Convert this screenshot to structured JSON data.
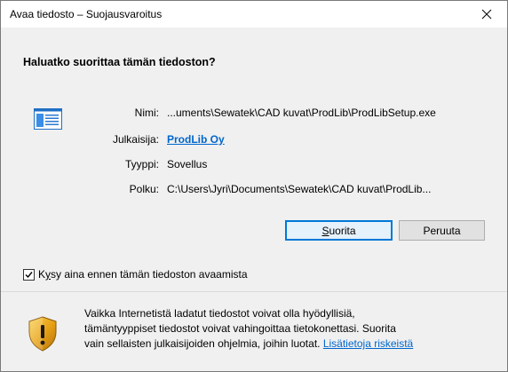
{
  "window": {
    "title": "Avaa tiedosto – Suojausvaroitus"
  },
  "heading": "Haluatko suorittaa tämän tiedoston?",
  "details": {
    "name_label": "Nimi:",
    "name_value": "...uments\\Sewatek\\CAD kuvat\\ProdLib\\ProdLibSetup.exe",
    "publisher_label": "Julkaisija:",
    "publisher_value": "ProdLib Oy",
    "type_label": "Tyyppi:",
    "type_value": "Sovellus",
    "path_label": "Polku:",
    "path_value": "C:\\Users\\Jyri\\Documents\\Sewatek\\CAD kuvat\\ProdLib..."
  },
  "buttons": {
    "run_mnemonic": "S",
    "run_rest": "uorita",
    "cancel": "Peruuta"
  },
  "checkbox": {
    "prefix": "K",
    "mnemonic": "y",
    "rest": "sy aina ennen tämän tiedoston avaamista",
    "checked": true
  },
  "warning": {
    "line1": "Vaikka Internetistä ladatut tiedostot voivat olla hyödyllisiä,",
    "line2": "tämäntyyppiset tiedostot voivat vahingoittaa tietokonettasi. Suorita",
    "line3": "vain sellaisten julkaisijoiden ohjelmia, joihin luotat.",
    "link": "Lisätietoja riskeistä"
  },
  "icons": {
    "close": "close-icon",
    "file": "application-window-icon",
    "shield": "security-shield-warning-icon",
    "check": "checkmark-icon"
  },
  "colors": {
    "link": "#0066cc",
    "default_button_border": "#0078d7",
    "shield_gold": "#e8a317"
  }
}
